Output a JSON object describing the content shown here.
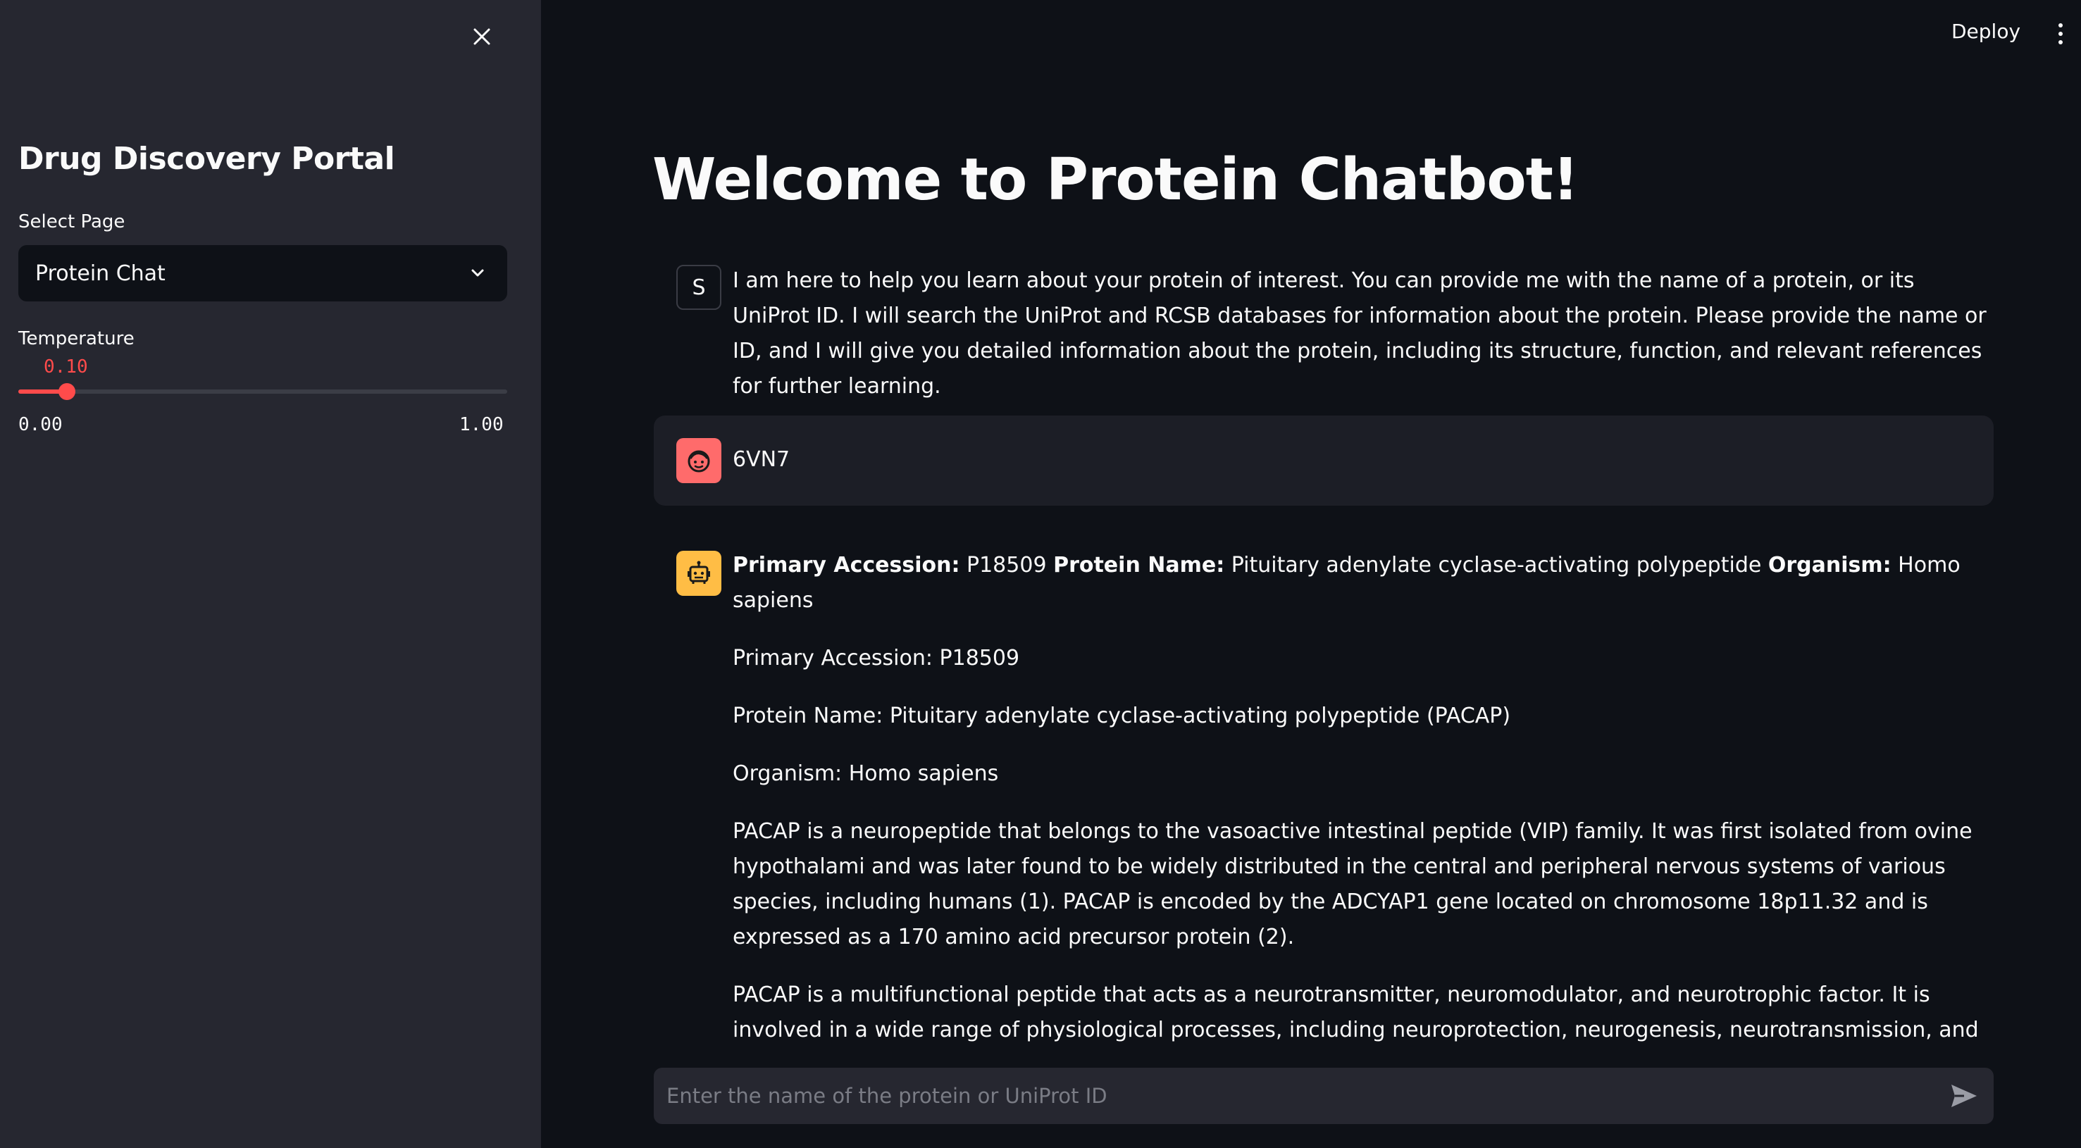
{
  "sidebar": {
    "title": "Drug Discovery Portal",
    "select_label": "Select Page",
    "select_value": "Protein Chat",
    "slider_label": "Temperature",
    "slider_value": "0.10",
    "slider_value_fraction": 0.1,
    "slider_min": "0.00",
    "slider_max": "1.00"
  },
  "header": {
    "deploy_label": "Deploy"
  },
  "main": {
    "title": "Welcome to Protein Chatbot!",
    "system_avatar": "S",
    "system_message": "I am here to help you learn about your protein of interest. You can provide me with the name of a protein, or its UniProt ID. I will search the UniProt and RCSB databases for information about the protein. Please provide the name or ID, and I will give you detailed information about the protein, including its structure, function, and relevant references for further learning.",
    "user_message": "6VN7",
    "bot": {
      "summary": {
        "accession_label": "Primary Accession:",
        "accession_value": " P18509 ",
        "name_label": "Protein Name:",
        "name_value": " Pituitary adenylate cyclase-activating polypeptide ",
        "organism_label": "Organism:",
        "organism_value": " Homo sapiens"
      },
      "line_accession": "Primary Accession: P18509",
      "line_name": "Protein Name: Pituitary adenylate cyclase-activating polypeptide (PACAP)",
      "line_organism": "Organism: Homo sapiens",
      "paragraph1": "PACAP is a neuropeptide that belongs to the vasoactive intestinal peptide (VIP) family. It was first isolated from ovine hypothalami and was later found to be widely distributed in the central and peripheral nervous systems of various species, including humans (1). PACAP is encoded by the ADCYAP1 gene located on chromosome 18p11.32 and is expressed as a 170 amino acid precursor protein (2).",
      "paragraph2": "PACAP is a multifunctional peptide that acts as a neurotransmitter, neuromodulator, and neurotrophic factor. It is involved in a wide range of physiological processes, including neuroprotection, neurogenesis, neurotransmission, and endocrine regulation (3). PACAP exerts its effects by binding to three G protein-coupled receptors: PAC1, VPAC1, and VPAC2 (4). These receptors are widely expressed in the central and peripheral nervous systems, as well as in various non-neuronal tissues, such as the immune system, cardiovascular"
    },
    "chat_input": {
      "placeholder": "Enter the name of the protein or UniProt ID"
    }
  },
  "colors": {
    "accent": "#ff4b4b",
    "sidebar_bg": "#262730",
    "main_bg": "#0e1117",
    "user_avatar": "#ff6b6b",
    "bot_avatar": "#ffbd45"
  },
  "icons": {
    "close": "close-icon",
    "chevron": "chevron-down-icon",
    "menu": "vertical-dots-icon",
    "user_avatar": "user-face-icon",
    "bot_avatar": "robot-icon",
    "send": "send-icon"
  }
}
